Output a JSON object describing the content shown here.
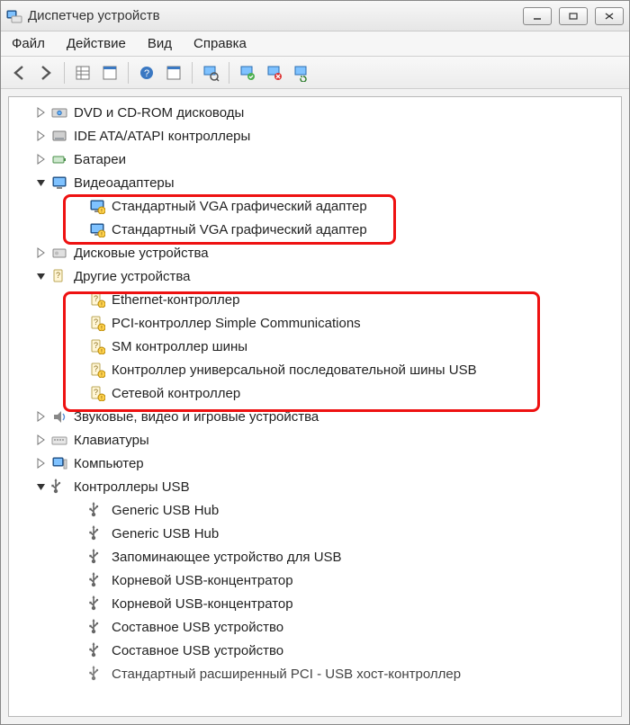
{
  "window": {
    "title": "Диспетчер устройств"
  },
  "menu": {
    "file": "Файл",
    "action": "Действие",
    "view": "Вид",
    "help": "Справка"
  },
  "tree": {
    "dvd": {
      "label": "DVD и CD-ROM дисководы"
    },
    "ide": {
      "label": "IDE ATA/ATAPI контроллеры"
    },
    "battery": {
      "label": "Батареи"
    },
    "video": {
      "label": "Видеоадаптеры"
    },
    "vga1": {
      "label": "Стандартный VGA графический адаптер"
    },
    "vga2": {
      "label": "Стандартный VGA графический адаптер"
    },
    "disks": {
      "label": "Дисковые устройства"
    },
    "other": {
      "label": "Другие устройства"
    },
    "eth": {
      "label": "Ethernet-контроллер"
    },
    "pci": {
      "label": "PCI-контроллер Simple Communications"
    },
    "sm": {
      "label": "SM контроллер шины"
    },
    "usbuniv": {
      "label": "Контроллер универсальной последовательной шины USB"
    },
    "netctl": {
      "label": "Сетевой контроллер"
    },
    "sound": {
      "label": "Звуковые, видео и игровые устройства"
    },
    "keyboard": {
      "label": "Клавиатуры"
    },
    "computer": {
      "label": "Компьютер"
    },
    "usbctl": {
      "label": "Контроллеры USB"
    },
    "ghub1": {
      "label": "Generic USB Hub"
    },
    "ghub2": {
      "label": "Generic USB Hub"
    },
    "usbstor": {
      "label": "Запоминающее устройство для USB"
    },
    "roothub1": {
      "label": "Корневой USB-концентратор"
    },
    "roothub2": {
      "label": "Корневой USB-концентратор"
    },
    "comp1": {
      "label": "Составное USB устройство"
    },
    "comp2": {
      "label": "Составное USB устройство"
    },
    "pcihost": {
      "label": "Стандартный расширенный PCI - USB хост-контроллер"
    }
  }
}
